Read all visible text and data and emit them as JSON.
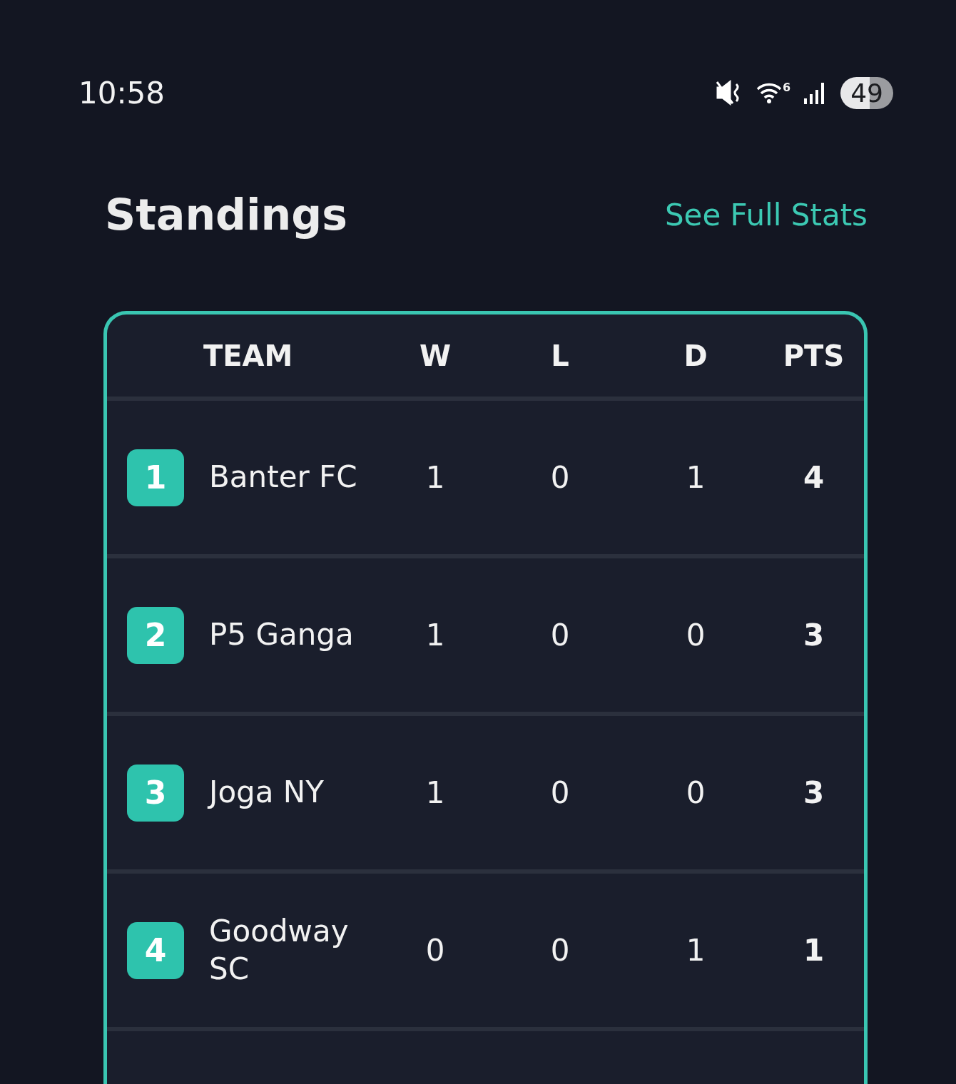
{
  "status_bar": {
    "time": "10:58",
    "wifi_label": "6",
    "battery": "49"
  },
  "header": {
    "title": "Standings",
    "link": "See Full Stats"
  },
  "table": {
    "columns": [
      "TEAM",
      "W",
      "L",
      "D",
      "PTS"
    ],
    "rows": [
      {
        "rank": "1",
        "team": "Banter FC",
        "w": "1",
        "l": "0",
        "d": "1",
        "pts": "4"
      },
      {
        "rank": "2",
        "team": "P5 Ganga",
        "w": "1",
        "l": "0",
        "d": "0",
        "pts": "3"
      },
      {
        "rank": "3",
        "team": "Joga NY",
        "w": "1",
        "l": "0",
        "d": "0",
        "pts": "3"
      },
      {
        "rank": "4",
        "team": "Goodway SC",
        "w": "0",
        "l": "0",
        "d": "1",
        "pts": "1"
      }
    ]
  }
}
